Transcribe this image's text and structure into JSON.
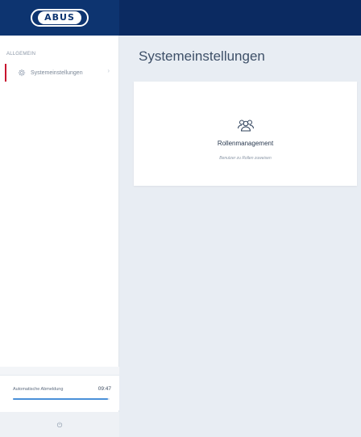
{
  "brand": {
    "logo_text": "ABUS"
  },
  "sidebar": {
    "section_heading": "ALLGEMEIN",
    "items": [
      {
        "label": "Systemeinstellungen",
        "icon": "gear-icon",
        "active": true
      }
    ],
    "auto_logout": {
      "label": "Automatische Abmeldung",
      "time": "09:47",
      "progress_fraction": 0.98
    },
    "power_icon": "power-icon"
  },
  "main": {
    "title": "Systemeinstellungen",
    "cards": [
      {
        "icon": "users-icon",
        "title": "Rollenmanagement",
        "subtitle": "Benutzer zu Rollen zuweisen"
      }
    ]
  },
  "colors": {
    "header": "#0b2a61",
    "accent_active": "#c8102e",
    "progress": "#4a90d9"
  }
}
